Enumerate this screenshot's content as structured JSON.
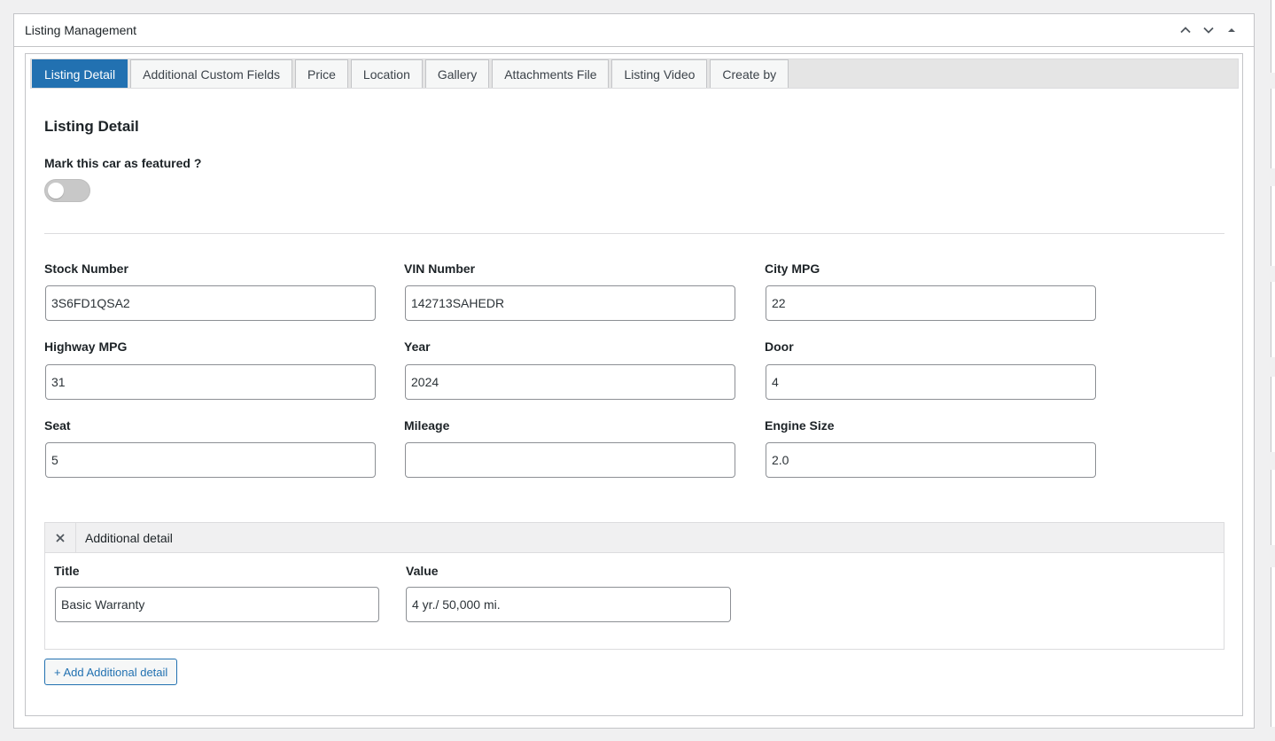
{
  "panel": {
    "title": "Listing Management",
    "controls": {
      "move_up_icon": "chevron-up-icon",
      "move_down_icon": "chevron-down-icon",
      "toggle_icon": "caret-up-icon"
    }
  },
  "tabs": [
    {
      "label": "Listing Detail",
      "active": true
    },
    {
      "label": "Additional Custom Fields",
      "active": false
    },
    {
      "label": "Price",
      "active": false
    },
    {
      "label": "Location",
      "active": false
    },
    {
      "label": "Gallery",
      "active": false
    },
    {
      "label": "Attachments File",
      "active": false
    },
    {
      "label": "Listing Video",
      "active": false
    },
    {
      "label": "Create by",
      "active": false
    }
  ],
  "detail": {
    "section_title": "Listing Detail",
    "featured_label": "Mark this car as featured ?",
    "featured_on": false,
    "fields": [
      {
        "label": "Stock Number",
        "value": "3S6FD1QSA2"
      },
      {
        "label": "VIN Number",
        "value": "142713SAHEDR"
      },
      {
        "label": "City MPG",
        "value": "22"
      },
      {
        "label": "Highway MPG",
        "value": "31"
      },
      {
        "label": "Year",
        "value": "2024"
      },
      {
        "label": "Door",
        "value": "4"
      },
      {
        "label": "Seat",
        "value": "5"
      },
      {
        "label": "Mileage",
        "value": ""
      },
      {
        "label": "Engine Size",
        "value": "2.0"
      }
    ]
  },
  "additional": {
    "header": "Additional detail",
    "title_label": "Title",
    "title_value": "Basic Warranty",
    "value_label": "Value",
    "value_value": "4 yr./ 50,000 mi.",
    "add_button": "+ Add Additional detail"
  },
  "colors": {
    "accent": "#2271b1",
    "border": "#c3c4c7",
    "background": "#f0f0f1"
  }
}
